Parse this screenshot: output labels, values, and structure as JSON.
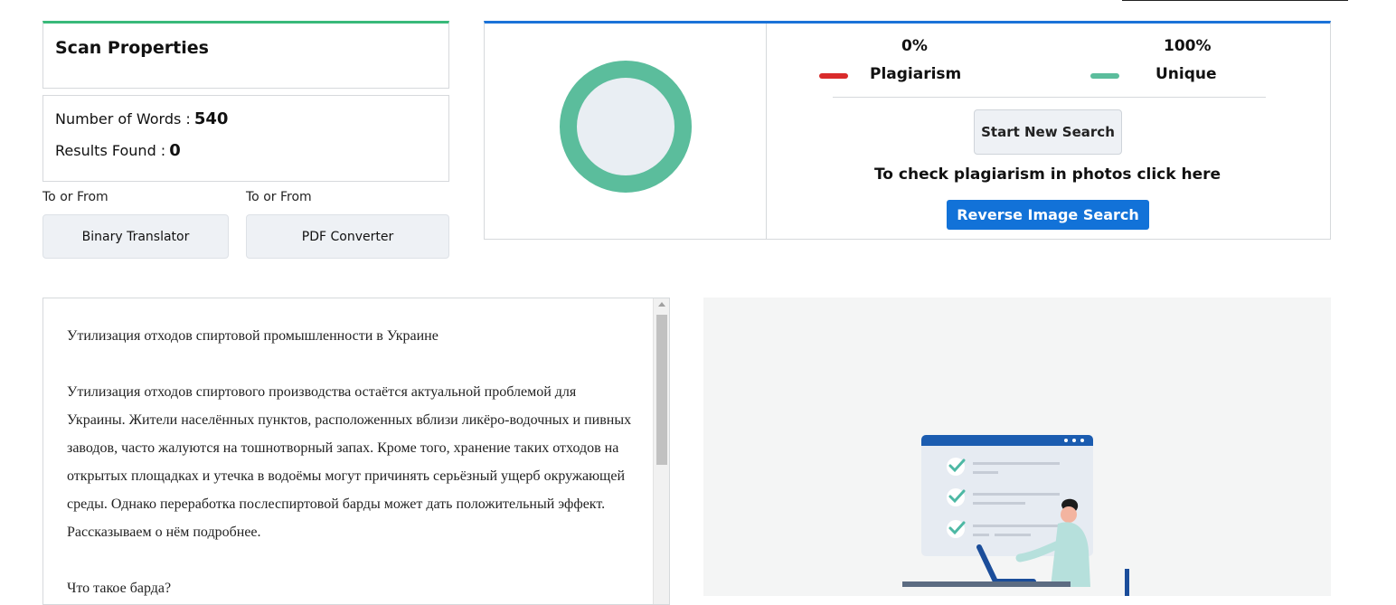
{
  "scan_properties": {
    "title": "Scan Properties",
    "words_label": "Number of Words :",
    "words_value": "540",
    "results_label": "Results Found :",
    "results_value": "0"
  },
  "tools": [
    {
      "caption": "To or From",
      "label": "Binary Translator"
    },
    {
      "caption": "To or From",
      "label": "PDF Converter"
    }
  ],
  "result": {
    "plagiarism_pct": "0%",
    "plagiarism_label": "Plagiarism",
    "unique_pct": "100%",
    "unique_label": "Unique",
    "plagiarism_value": 0,
    "unique_value": 100,
    "colors": {
      "plagiarism": "#d92b2b",
      "unique": "#5bbd9c",
      "donut_center": "#e9eef3"
    },
    "new_search_label": "Start New Search",
    "photos_text": "To check plagiarism in photos click here",
    "reverse_image_label": "Reverse Image Search"
  },
  "document": {
    "paragraphs": [
      "Утилизация отходов спиртовой промышленности в Украине",
      "Утилизация отходов спиртового производства остаётся актуальной проблемой для Украины. Жители населённых пунктов, расположенных вблизи ликёро-водочных и пивных заводов, часто жалуются на тошнотворный запах. Кроме того, хранение таких отходов на открытых площадках и утечка в водоёмы могут причинять серьёзный ущерб окружающей среды. Однако переработка послеспиртовой барды может дать положительный эффект. Рассказываем о нём подробнее.",
      "Что такое барда?"
    ]
  }
}
